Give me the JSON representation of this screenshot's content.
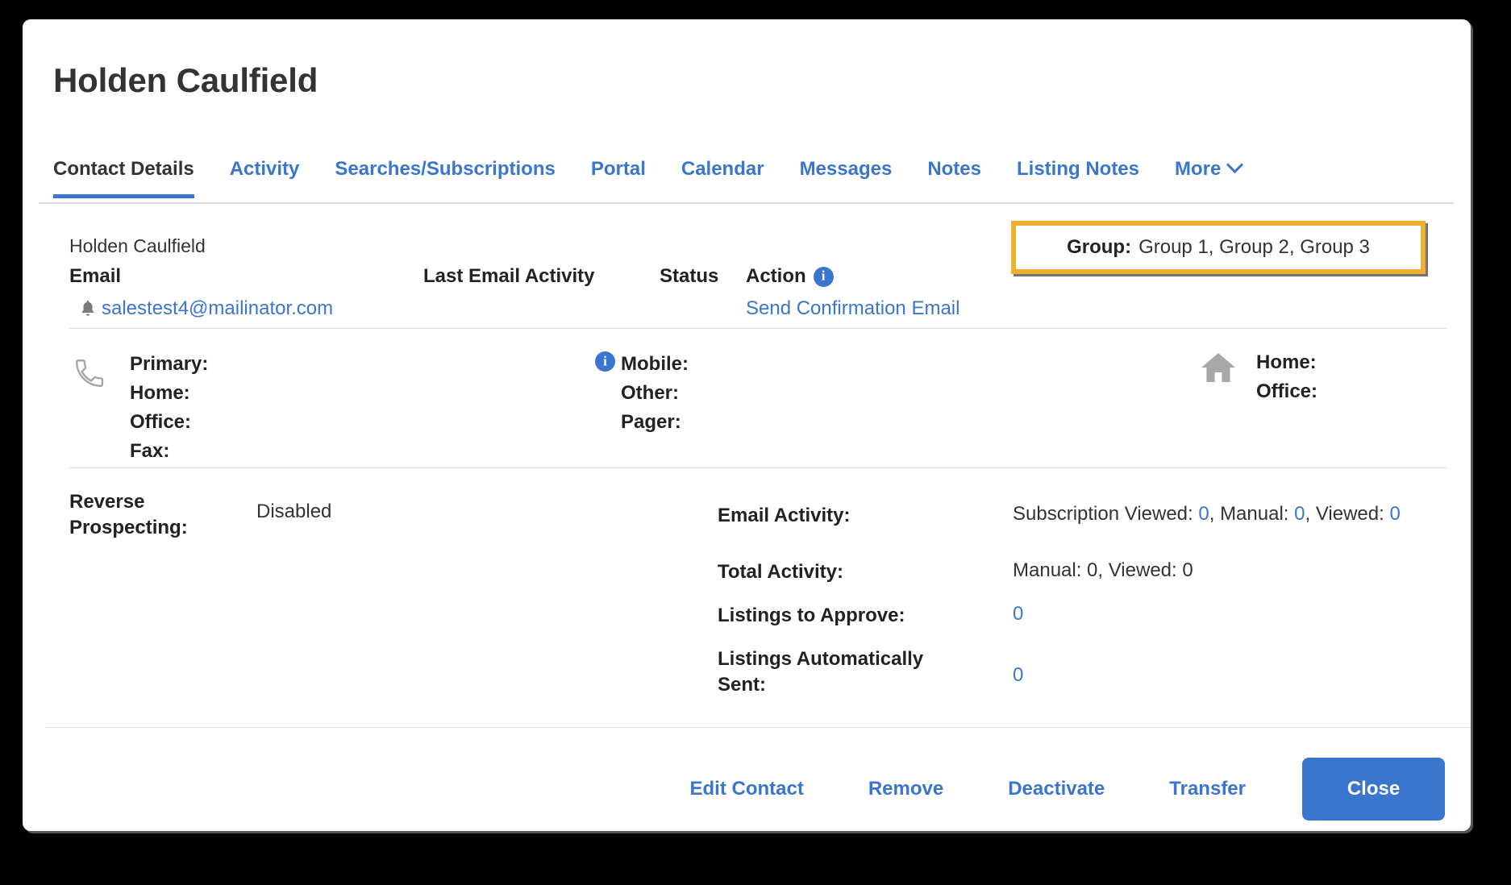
{
  "modal": {
    "title": "Holden Caulfield"
  },
  "tabs": [
    {
      "label": "Contact Details",
      "active": true
    },
    {
      "label": "Activity",
      "active": false
    },
    {
      "label": "Searches/Subscriptions",
      "active": false
    },
    {
      "label": "Portal",
      "active": false
    },
    {
      "label": "Calendar",
      "active": false
    },
    {
      "label": "Messages",
      "active": false
    },
    {
      "label": "Notes",
      "active": false
    },
    {
      "label": "Listing Notes",
      "active": false
    },
    {
      "label": "More",
      "active": false,
      "icon": "chevron-down-icon"
    }
  ],
  "contact": {
    "sub_name": "Holden Caulfield",
    "columns": {
      "email": "Email",
      "last_email_activity": "Last Email Activity",
      "status": "Status",
      "action": "Action",
      "action_info_icon": "info-icon"
    },
    "email_value": "salestest4@mailinator.com",
    "email_bell_icon": "bell-icon",
    "last_email_activity_value": "",
    "status_value": "",
    "action_link": "Send Confirmation Email"
  },
  "group_highlight": {
    "label": "Group:",
    "value": "Group 1, Group 2, Group 3",
    "border_color": "#eeb02e"
  },
  "phones": {
    "phone_icon": "phone-icon",
    "info_icon": "info-icon",
    "home_icon": "house-icon",
    "column_a": [
      "Primary:",
      "Home:",
      "Office:",
      "Fax:"
    ],
    "column_b": [
      "Mobile:",
      "Other:",
      "Pager:"
    ],
    "column_c": [
      "Home:",
      "Office:"
    ]
  },
  "details": {
    "reverse_prospecting_label": "Reverse Prospecting:",
    "reverse_prospecting_value": "Disabled",
    "email_activity_label": "Email Activity:",
    "email_activity": {
      "subscription_viewed_label": "Subscription Viewed:",
      "subscription_viewed": "0",
      "manual_label": "Manual:",
      "manual": "0",
      "viewed_label": "Viewed:",
      "viewed": "0"
    },
    "total_activity_label": "Total Activity:",
    "total_activity_value": "Manual: 0, Viewed: 0",
    "listings_to_approve_label": "Listings to Approve:",
    "listings_to_approve_value": "0",
    "listings_automatically_sent_label": "Listings Automatically Sent:",
    "listings_automatically_sent_value": "0"
  },
  "footer": {
    "edit_contact": "Edit Contact",
    "remove": "Remove",
    "deactivate": "Deactivate",
    "transfer": "Transfer",
    "close": "Close"
  },
  "colors": {
    "link_blue": "#3a76cd",
    "highlight_gold": "#eeb02e",
    "text_dark": "#222222"
  }
}
